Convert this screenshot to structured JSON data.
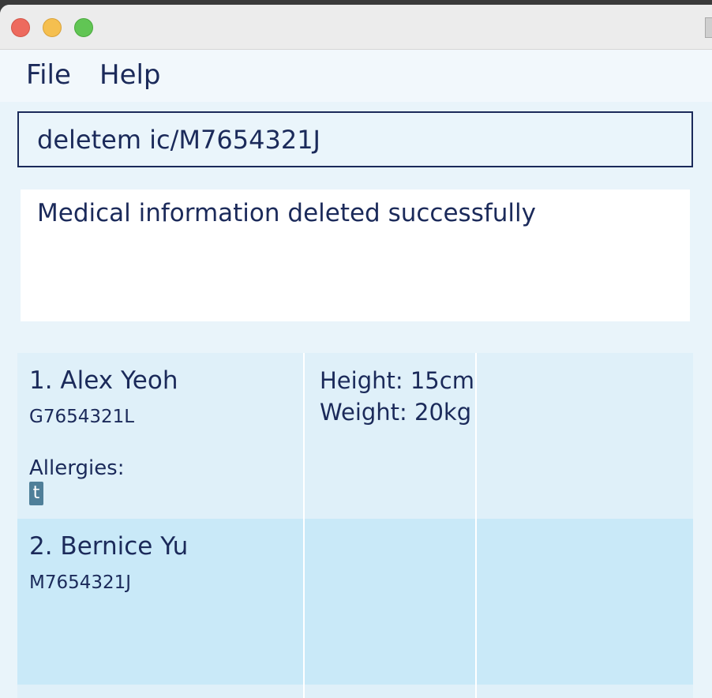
{
  "menu": {
    "items": [
      {
        "label": "File"
      },
      {
        "label": "Help"
      }
    ]
  },
  "command": {
    "value": "deletem ic/M7654321J"
  },
  "result": {
    "message": "Medical information deleted successfully"
  },
  "persons": [
    {
      "name": "1. Alex Yeoh",
      "ic": "G7654321L",
      "allergies_label": "Allergies:",
      "tags": [
        "t"
      ],
      "height": "Height: 15cm",
      "weight": "Weight: 20kg"
    },
    {
      "name": "2. Bernice Yu",
      "ic": "M7654321J"
    }
  ],
  "colors": {
    "text": "#1b2a5a",
    "row_primary": "#dff0f9",
    "row_alt": "#c9e9f8",
    "tag_bg": "#4f7f99"
  }
}
